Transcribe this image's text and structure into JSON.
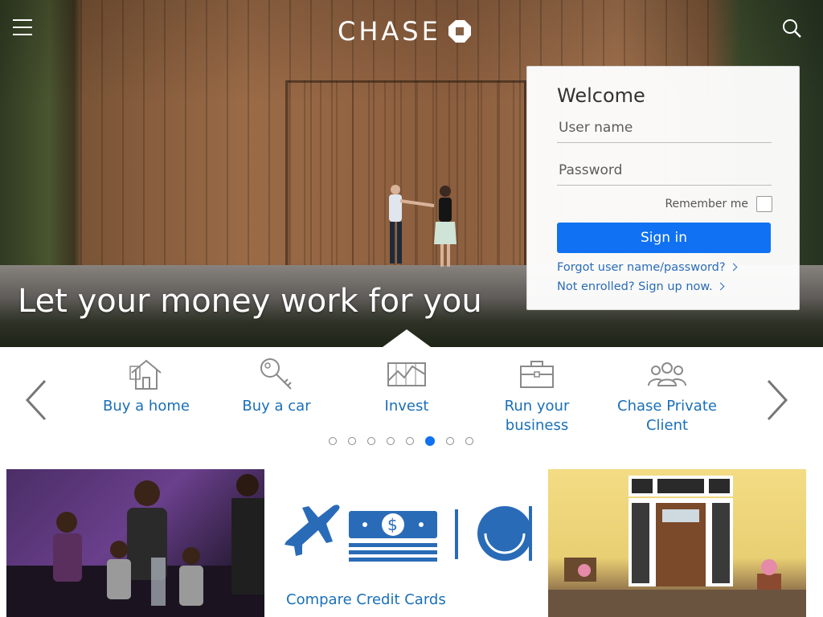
{
  "brand": {
    "name": "CHASE",
    "accent": "#1071f2",
    "link_color": "#2a6bb8"
  },
  "header": {
    "menu_icon": "hamburger-menu-icon",
    "search_icon": "search-icon"
  },
  "hero": {
    "headline": "Let your money work for you"
  },
  "login": {
    "title": "Welcome",
    "username_placeholder": "User name",
    "password_placeholder": "Password",
    "remember_label": "Remember me",
    "signin_label": "Sign in",
    "forgot_link": "Forgot user name/password?",
    "enroll_link": "Not enrolled? Sign up now."
  },
  "carousel": {
    "items": [
      {
        "label": "Buy a home",
        "icon": "house-icon"
      },
      {
        "label": "Buy a car",
        "icon": "car-key-icon"
      },
      {
        "label": "Invest",
        "icon": "chart-icon"
      },
      {
        "label": "Run your business",
        "icon": "briefcase-icon"
      },
      {
        "label": "Chase Private Client",
        "icon": "people-icon"
      }
    ],
    "dot_count": 8,
    "active_dot": 6
  },
  "cards": {
    "middle_cta": "Compare Credit Cards"
  }
}
